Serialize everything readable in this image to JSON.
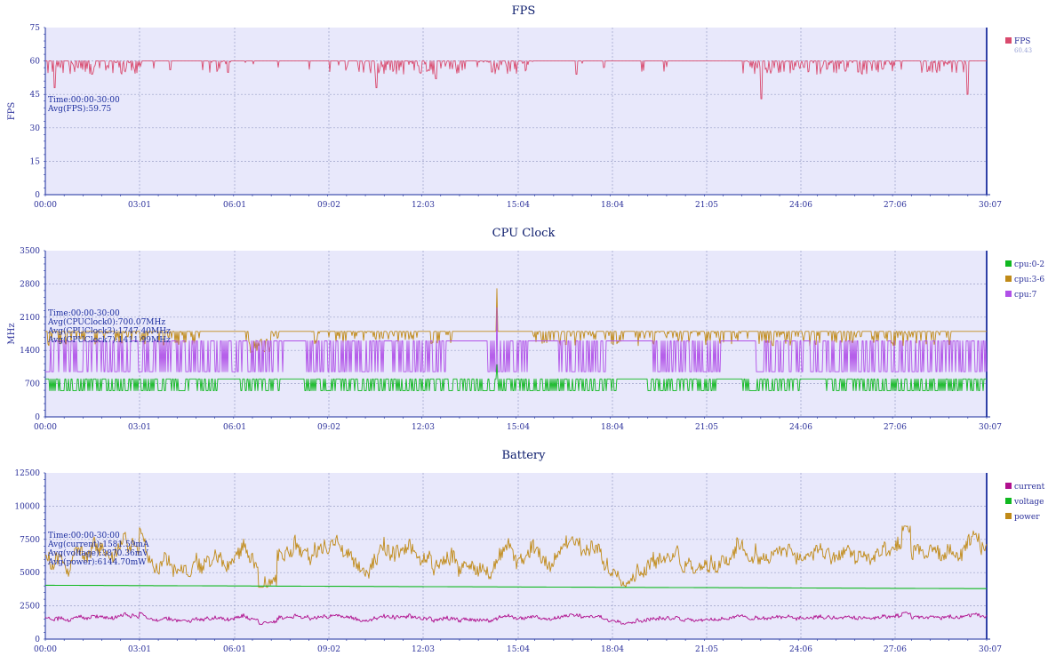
{
  "chart_data": [
    {
      "type": "line",
      "title": "FPS",
      "ylabel": "FPS",
      "xlabel": "",
      "x_ticks": [
        "00:00",
        "03:01",
        "06:01",
        "09:02",
        "12:03",
        "15:04",
        "18:04",
        "21:05",
        "24:06",
        "27:06",
        "30:07"
      ],
      "x_range_minutes": [
        0,
        30.12
      ],
      "ylim": [
        0,
        75
      ],
      "y_ticks": [
        "0",
        "15",
        "30",
        "45",
        "60",
        "75"
      ],
      "grid": true,
      "legend_position": "right",
      "annotation": [
        "Time:00:00-30:00",
        "Avg(FPS):59.75"
      ],
      "series": [
        {
          "name": "FPS",
          "legend_value": "60.43",
          "color": "#d94a6e",
          "pattern": {
            "baseline": 60,
            "dips": [
              [
                0.3,
                48
              ],
              [
                1.5,
                54
              ],
              [
                4.0,
                56
              ],
              [
                10.6,
                48
              ],
              [
                12.5,
                52
              ],
              [
                14.3,
                55
              ],
              [
                17.0,
                54
              ],
              [
                22.9,
                43
              ],
              [
                26.0,
                55
              ],
              [
                29.5,
                45
              ]
            ],
            "min_estimated": 43,
            "max_estimated": 61
          }
        }
      ]
    },
    {
      "type": "line",
      "title": "CPU Clock",
      "ylabel": "MHz",
      "xlabel": "",
      "x_ticks": [
        "00:00",
        "03:01",
        "06:01",
        "09:02",
        "12:03",
        "15:04",
        "18:04",
        "21:05",
        "24:06",
        "27:06",
        "30:07"
      ],
      "ylim": [
        0,
        3500
      ],
      "y_ticks": [
        "0",
        "700",
        "1400",
        "2100",
        "2800",
        "3500"
      ],
      "grid": true,
      "legend_position": "right",
      "annotation": [
        "Time:00:00-30:00",
        "Avg(CPUClock0):700.07MHz",
        "Avg(CPUClock3):1747.40MHz",
        "Avg(CPUClock7):1411.99MHz"
      ],
      "series": [
        {
          "name": "cpu:0-2",
          "color": "#10b820",
          "levels": [
            550,
            800
          ],
          "spike": [
            14.45,
            1100
          ]
        },
        {
          "name": "cpu:3-6",
          "color": "#c08a18",
          "levels": [
            1500,
            1800
          ],
          "spike": [
            14.45,
            2700
          ]
        },
        {
          "name": "cpu:7",
          "color": "#b050e8",
          "levels": [
            950,
            1600
          ],
          "spike": [
            14.45,
            2300
          ]
        }
      ]
    },
    {
      "type": "line",
      "title": "Battery",
      "ylabel": "",
      "xlabel": "",
      "x_ticks": [
        "00:00",
        "03:01",
        "06:01",
        "09:02",
        "12:03",
        "15:04",
        "18:04",
        "21:05",
        "24:06",
        "27:06",
        "30:07"
      ],
      "ylim": [
        0,
        12500
      ],
      "y_ticks": [
        "0",
        "2500",
        "5000",
        "7500",
        "10000",
        "12500"
      ],
      "grid": true,
      "legend_position": "right",
      "annotation": [
        "Time:00:00-30:00",
        "Avg(current):1581.59mA",
        "Avg(voltage):3870.36mV",
        "Avg(power):6144.70mW"
      ],
      "series": [
        {
          "name": "current",
          "color": "#b0108e",
          "approx_range": [
            1100,
            2300
          ],
          "mean": 1581.59
        },
        {
          "name": "voltage",
          "color": "#10b820",
          "approx_range": [
            3800,
            4050
          ],
          "mean": 3870.36
        },
        {
          "name": "power",
          "color": "#c08a18",
          "approx_range": [
            3900,
            8500
          ],
          "mean": 6144.7
        }
      ]
    }
  ]
}
